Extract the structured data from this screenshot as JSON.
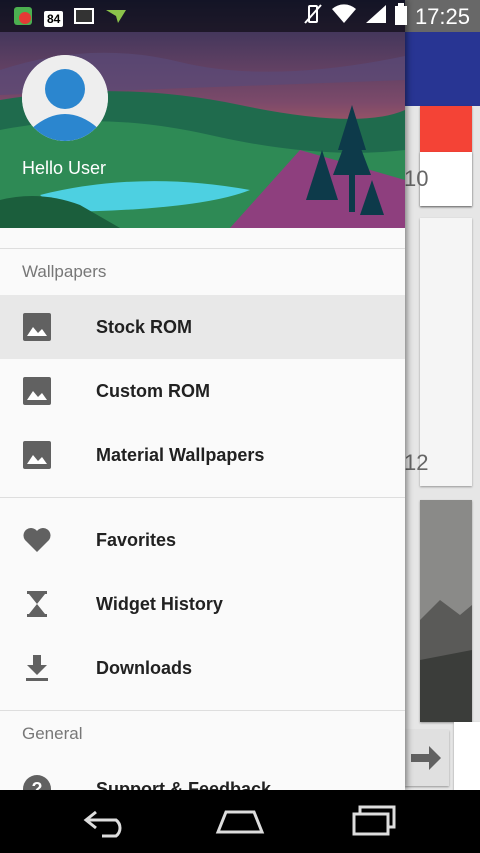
{
  "status_bar": {
    "badge_value": "84",
    "time": "17:25",
    "icons": [
      "app-notification-icon",
      "battery-84-icon",
      "screenshot-icon",
      "send-icon",
      "vibrate-icon",
      "wifi-icon",
      "signal-icon",
      "battery-icon"
    ]
  },
  "drawer": {
    "user_greeting": "Hello User",
    "sections": [
      {
        "title": "Wallpapers",
        "items": [
          {
            "label": "Stock ROM",
            "icon": "image-icon",
            "active": true
          },
          {
            "label": "Custom ROM",
            "icon": "image-icon"
          },
          {
            "label": "Material Wallpapers",
            "icon": "image-icon"
          }
        ]
      },
      {
        "title": "",
        "items": [
          {
            "label": "Favorites",
            "icon": "heart-icon"
          },
          {
            "label": "Widget History",
            "icon": "hourglass-icon"
          },
          {
            "label": "Downloads",
            "icon": "download-icon"
          }
        ]
      },
      {
        "title": "General",
        "items": [
          {
            "label": "Support & Feedback",
            "icon": "help-icon"
          }
        ]
      }
    ]
  },
  "background_app": {
    "card_numbers": [
      "10",
      "12"
    ],
    "toolbar_color": "#283593"
  },
  "colors": {
    "icon": "#616161",
    "active_bg": "#e8e8e8"
  }
}
